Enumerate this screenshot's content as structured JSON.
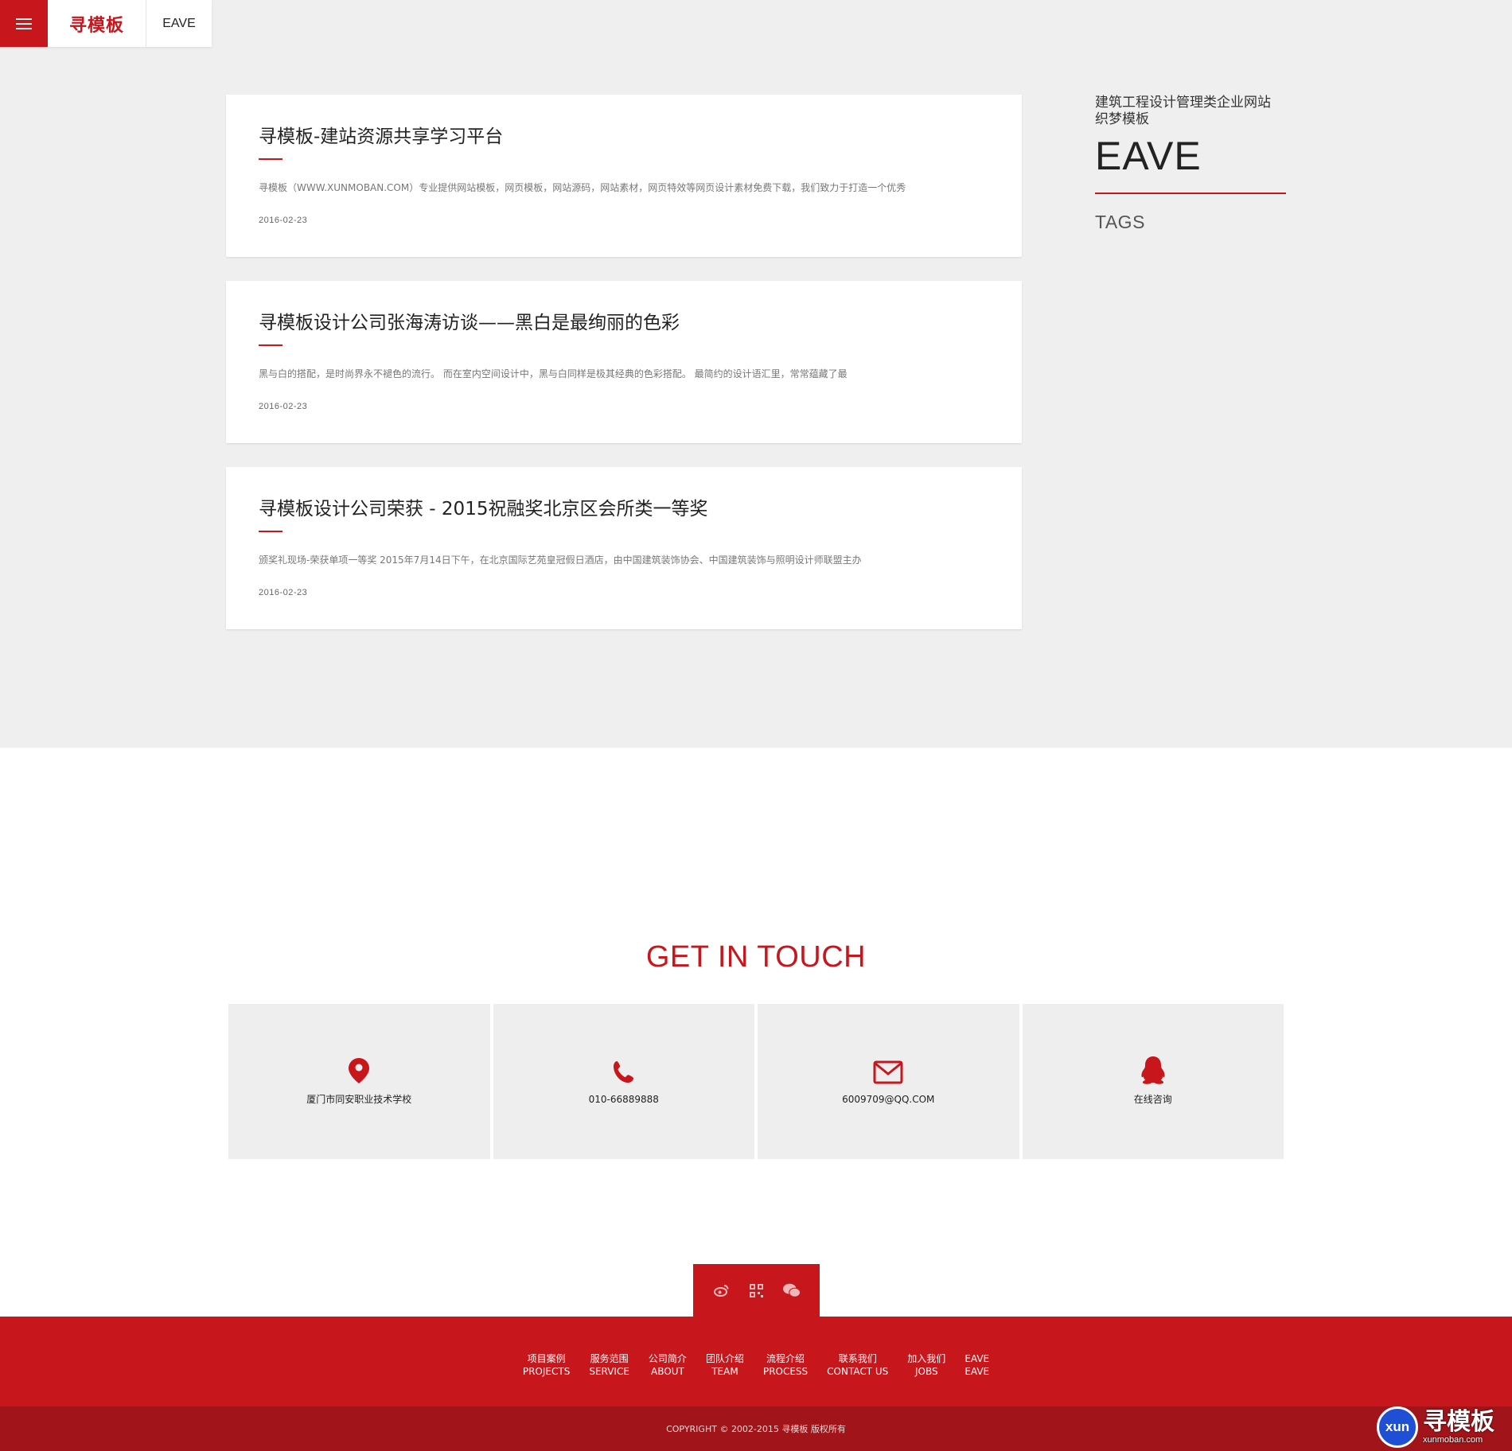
{
  "header": {
    "logo_text": "寻模板",
    "site_name": "EAVE"
  },
  "articles": [
    {
      "title": "寻模板-建站资源共享学习平台",
      "excerpt": "寻模板（WWW.XUNMOBAN.COM）专业提供网站模板，网页模板，网站源码，网站素材，网页特效等网页设计素材免费下载，我们致力于打造一个优秀",
      "date": "2016-02-23"
    },
    {
      "title": "寻模板设计公司张海涛访谈——黑白是最绚丽的色彩",
      "excerpt": "黑与白的搭配，是时尚界永不褪色的流行。 而在室内空间设计中，黑与白同样是极其经典的色彩搭配。 最简约的设计语汇里，常常蕴藏了最",
      "date": "2016-02-23"
    },
    {
      "title": "寻模板设计公司荣获 - 2015祝融奖北京区会所类一等奖",
      "excerpt": "颁奖礼现场-荣获单项一等奖 2015年7月14日下午，在北京国际艺苑皇冠假日酒店，由中国建筑装饰协会、中国建筑装饰与照明设计师联盟主办",
      "date": "2016-02-23"
    }
  ],
  "sidebar": {
    "subtitle_line1": "建筑工程设计管理类企业网站",
    "subtitle_line2": "织梦模板",
    "big_title": "EAVE",
    "tags_label": "TAGS"
  },
  "contact": {
    "title": "GET IN TOUCH",
    "items": [
      {
        "icon": "location-pin-icon",
        "text": "厦门市同安职业技术学校"
      },
      {
        "icon": "phone-icon",
        "text": "010-66889888"
      },
      {
        "icon": "mail-icon",
        "text": "6009709@QQ.COM"
      },
      {
        "icon": "qq-icon",
        "text": "在线咨询"
      }
    ]
  },
  "social": [
    "weibo-icon",
    "qrcode-icon",
    "wechat-icon"
  ],
  "footer": {
    "nav": [
      {
        "cn": "项目案例",
        "en": "PROJECTS"
      },
      {
        "cn": "服务范围",
        "en": "SERVICE"
      },
      {
        "cn": "公司简介",
        "en": "ABOUT"
      },
      {
        "cn": "团队介绍",
        "en": "TEAM"
      },
      {
        "cn": "流程介绍",
        "en": "PROCESS"
      },
      {
        "cn": "联系我们",
        "en": "CONTACT US"
      },
      {
        "cn": "加入我们",
        "en": "JOBS"
      },
      {
        "cn": "EAVE",
        "en": "EAVE"
      }
    ],
    "copyright": "COPYRIGHT © 2002-2015 寻模板 版权所有"
  },
  "badge": {
    "circle_text": "xun",
    "brand": "寻模板",
    "url": "xunmoban.com"
  },
  "colors": {
    "accent": "#c8161d",
    "accent_dark": "#a11419",
    "background_gray": "#efefef",
    "badge_blue": "#1f4fd4"
  }
}
